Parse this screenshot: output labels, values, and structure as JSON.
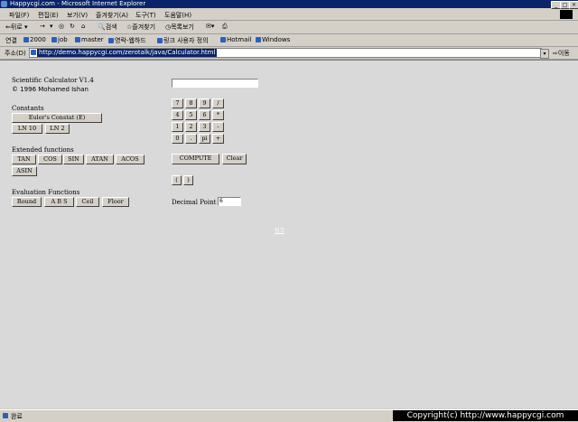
{
  "window": {
    "title": "Happycgi.com - Microsoft Internet Explorer",
    "controls": [
      "_",
      "□",
      "×"
    ]
  },
  "menu": [
    "파일(F)",
    "편집(E)",
    "보기(V)",
    "즐겨찾기(A)",
    "도구(T)",
    "도움말(H)"
  ],
  "toolbar": {
    "back": "뒤로",
    "forward": "→",
    "search": "검색",
    "favorites": "즐겨찾기",
    "history": "목록보기"
  },
  "links": {
    "label": "연결",
    "items": [
      "2000",
      "job",
      "master",
      "영락-웹하드",
      "링크 사용자 정의",
      "Hotmail",
      "Windows"
    ]
  },
  "address": {
    "label": "주소(D)",
    "url": "http://demo.happycgi.com/zerotalk/java/Calculator.html",
    "go": "이동"
  },
  "calc": {
    "title": "Scientific Calculator V1.4",
    "author": "© 1996 Mohamed Ishan",
    "constants_heading": "Constants",
    "euler_btn": "Euler's Constat (E)",
    "ln10_btn": "LN 10",
    "ln2_btn": "LN 2",
    "extended_heading": "Extended functions",
    "extended_btns": [
      "TAN",
      "COS",
      "SIN",
      "ATAN",
      "ACOS",
      "ASIN"
    ],
    "evaluation_heading": "Evaluation Functions",
    "evaluation_btns": [
      "Round",
      "A B S",
      "Ceil",
      "Floor"
    ],
    "display_value": "",
    "keypad": [
      [
        "7",
        "8",
        "9",
        "/"
      ],
      [
        "4",
        "5",
        "6",
        "*"
      ],
      [
        "1",
        "2",
        "3",
        "-"
      ],
      [
        "0",
        ".",
        "pi",
        "+"
      ]
    ],
    "compute_btn": "COMPUTE",
    "clear_btn": "Clear",
    "paren_open": "(",
    "paren_close": ")",
    "decimal_label": "Decimal Point",
    "decimal_value": "6",
    "link_text": "링크"
  },
  "status": {
    "text": "완료",
    "copyright": "Copyright(c) http://www.happycgi.com"
  },
  "colors": {
    "titlebar": "#0a246a",
    "chrome": "#d4d0c8",
    "content_bg": "#d9d9d9"
  }
}
